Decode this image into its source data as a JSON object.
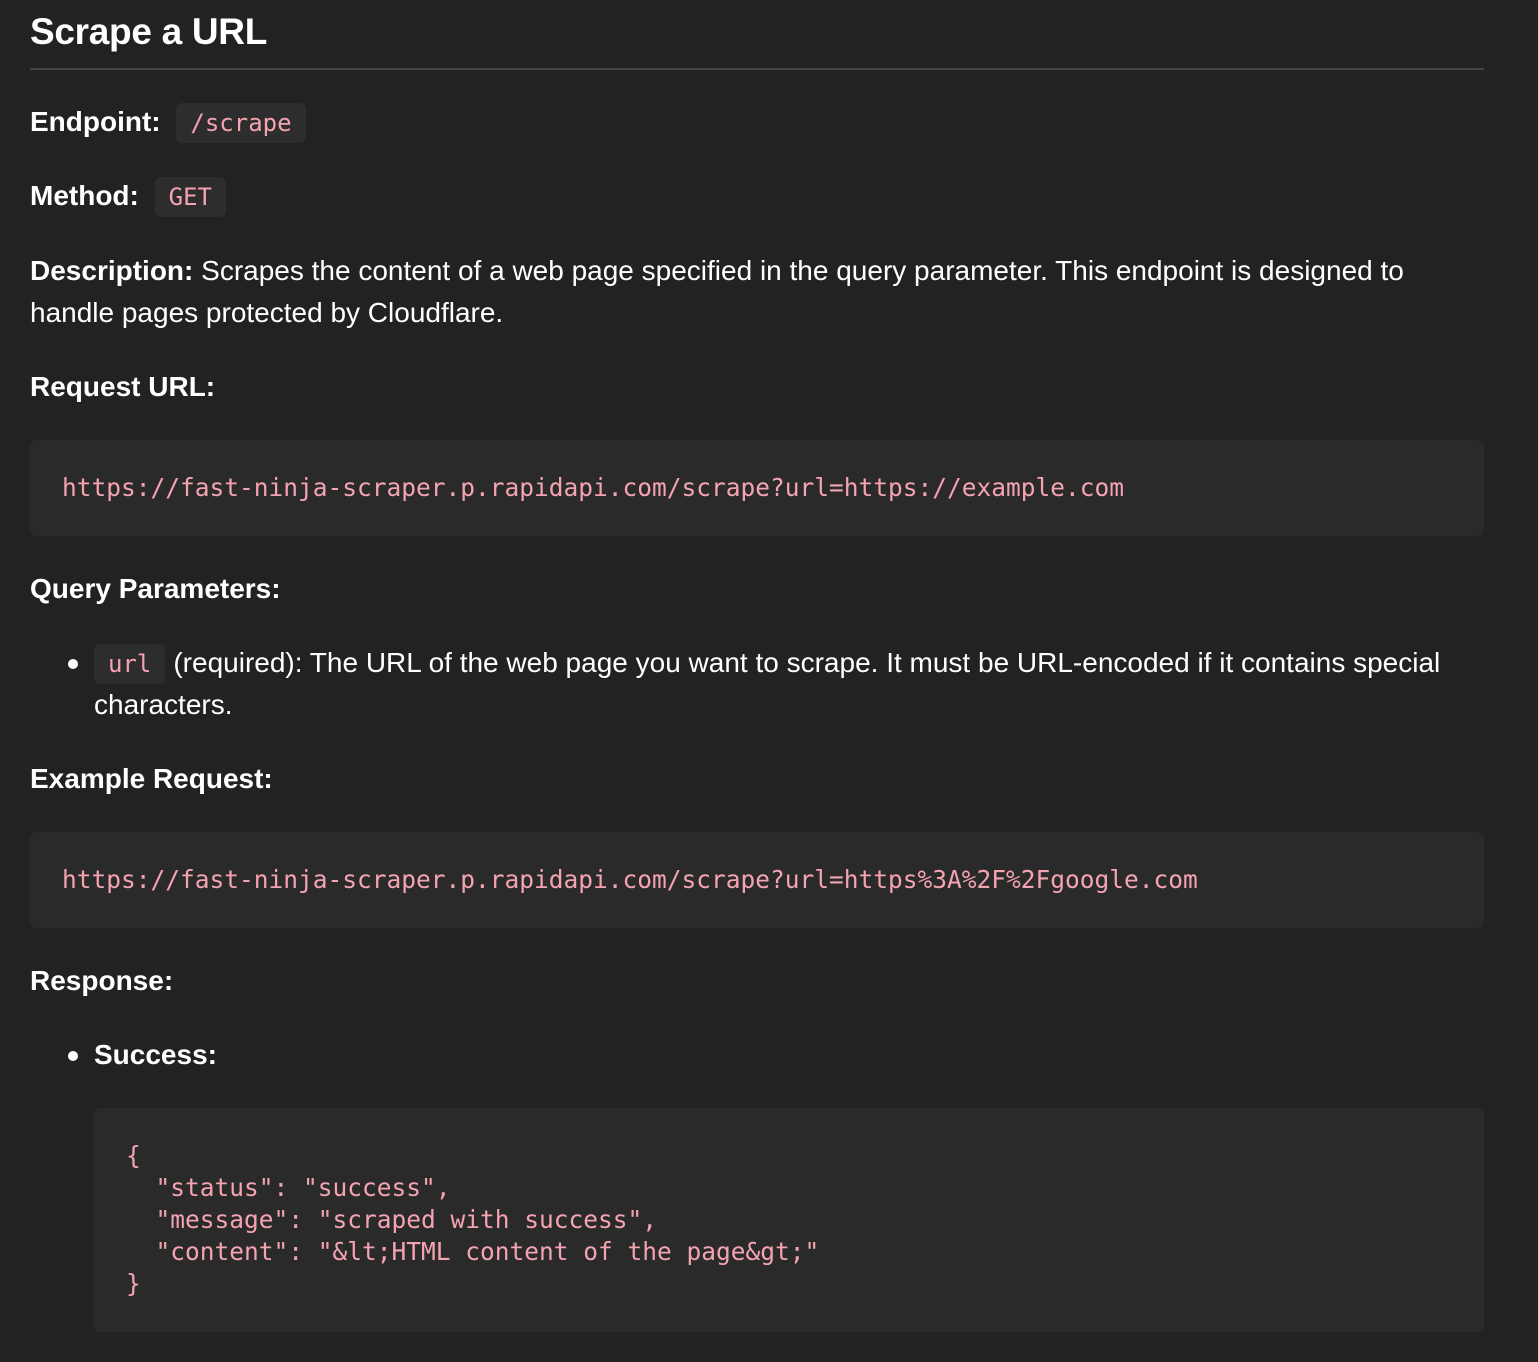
{
  "title": "Scrape a URL",
  "endpoint": {
    "label": "Endpoint:",
    "value": "/scrape"
  },
  "method": {
    "label": "Method:",
    "value": "GET"
  },
  "description": {
    "label": "Description:",
    "text": " Scrapes the content of a web page specified in the query parameter. This endpoint is designed to handle pages protected by Cloudflare."
  },
  "request_url": {
    "label": "Request URL:",
    "code": "https://fast-ninja-scraper.p.rapidapi.com/scrape?url=https://example.com"
  },
  "query_parameters": {
    "label": "Query Parameters:",
    "items": [
      {
        "name": "url",
        "text": "(required): The URL of the web page you want to scrape. It must be URL-encoded if it contains special characters."
      }
    ]
  },
  "example_request": {
    "label": "Example Request:",
    "code": "https://fast-ninja-scraper.p.rapidapi.com/scrape?url=https%3A%2F%2Fgoogle.com"
  },
  "response": {
    "label": "Response:",
    "items": [
      {
        "label": "Success:",
        "code": "{\n  \"status\": \"success\",\n  \"message\": \"scraped with success\",\n  \"content\": \"&lt;HTML content of the page&gt;\"\n}"
      }
    ]
  },
  "colors": {
    "background": "#222222",
    "code_text": "#f4a3b0",
    "code_background": "#2a2a2a",
    "text": "#ffffff"
  }
}
